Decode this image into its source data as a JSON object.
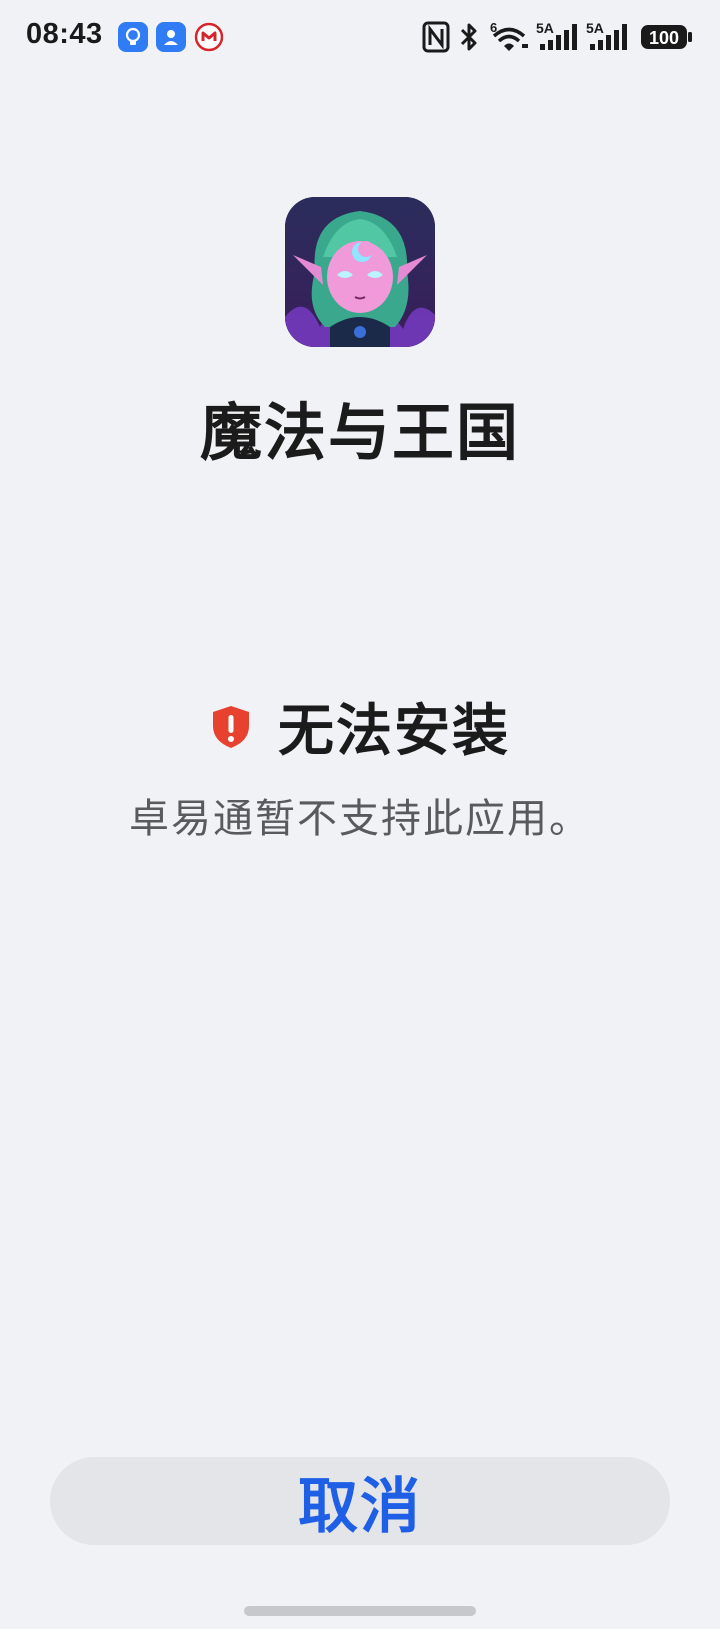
{
  "status_bar": {
    "time": "08:43",
    "notification_icons": [
      "lightbulb-icon",
      "profile-icon",
      "bank-icon"
    ],
    "system_icons": [
      "nfc-icon",
      "bluetooth-icon",
      "wifi-icon",
      "signal-5a-icon",
      "signal-5a-icon",
      "battery-icon"
    ],
    "battery_text": "100",
    "network_labels": [
      "6",
      "5A",
      "5A"
    ]
  },
  "app": {
    "name": "魔法与王国",
    "icon": "game-character-icon"
  },
  "install_status": {
    "title": "无法安装",
    "detail": "卓易通暂不支持此应用。",
    "icon": "shield-alert-icon",
    "icon_color": "#e6422f"
  },
  "actions": {
    "cancel_label": "取消",
    "accent_color": "#1f5fe6"
  }
}
